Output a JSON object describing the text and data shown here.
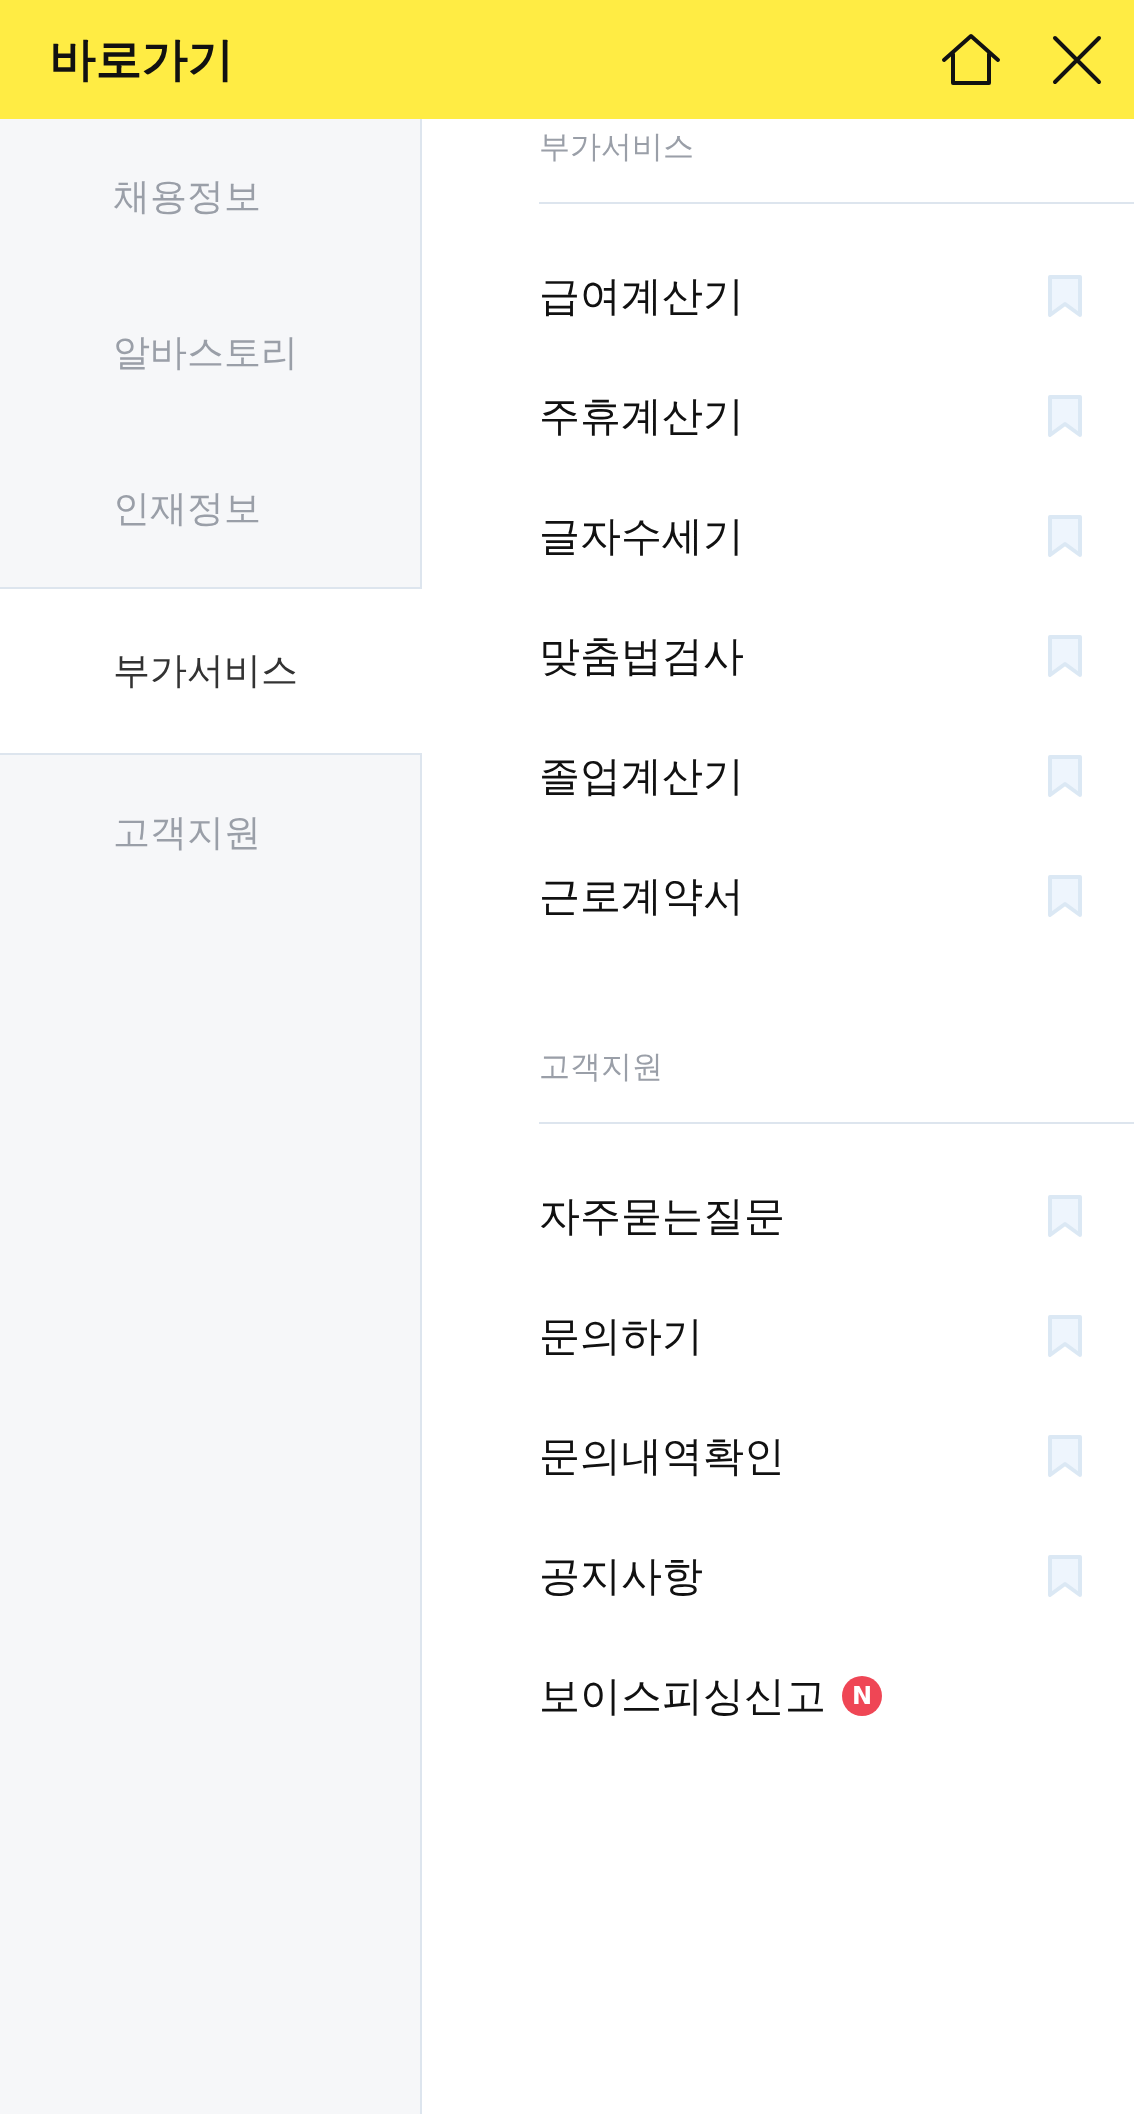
{
  "header": {
    "title": "바로가기"
  },
  "sidebar": {
    "items": [
      {
        "label": "채용정보",
        "selected": false
      },
      {
        "label": "알바스토리",
        "selected": false
      },
      {
        "label": "인재정보",
        "selected": false
      },
      {
        "label": "부가서비스",
        "selected": true
      },
      {
        "label": "고객지원",
        "selected": false
      }
    ]
  },
  "sections": [
    {
      "title": "부가서비스",
      "items": [
        {
          "label": "급여계산기",
          "kind": "bookmark"
        },
        {
          "label": "주휴계산기",
          "kind": "bookmark"
        },
        {
          "label": "글자수세기",
          "kind": "bookmark"
        },
        {
          "label": "맞춤법검사",
          "kind": "bookmark"
        },
        {
          "label": "졸업계산기",
          "kind": "bookmark"
        },
        {
          "label": "근로계약서",
          "kind": "bookmark"
        }
      ]
    },
    {
      "title": "고객지원",
      "items": [
        {
          "label": "자주묻는질문",
          "kind": "bookmark"
        },
        {
          "label": "문의하기",
          "kind": "bookmark"
        },
        {
          "label": "문의내역확인",
          "kind": "bookmark"
        },
        {
          "label": "공지사항",
          "kind": "bookmark"
        },
        {
          "label": "보이스피싱신고",
          "kind": "new",
          "badge": "N"
        }
      ]
    }
  ]
}
